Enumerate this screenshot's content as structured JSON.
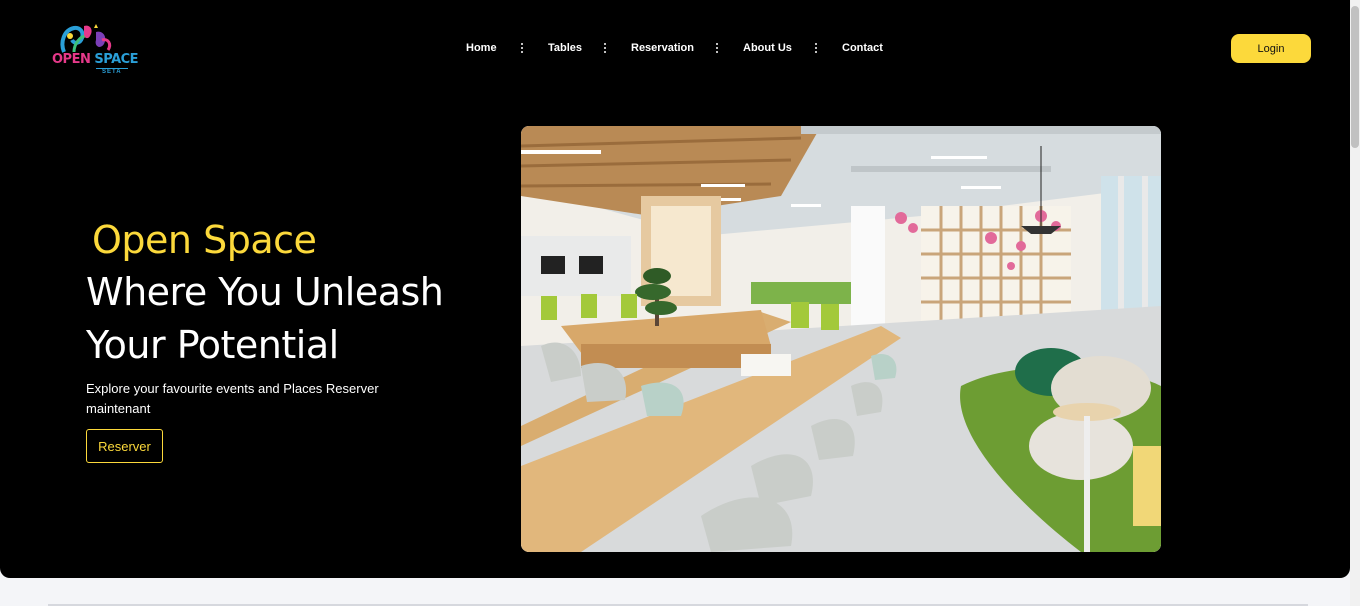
{
  "brand": {
    "logo_word1": "OPEN",
    "logo_word2": "SPACE",
    "logo_sub": "SETA"
  },
  "nav": {
    "items": [
      {
        "label": "Home"
      },
      {
        "label": "Tables"
      },
      {
        "label": "Reservation"
      },
      {
        "label": "About Us"
      },
      {
        "label": "Contact"
      }
    ],
    "login_label": "Login"
  },
  "hero": {
    "accent_title": "Open Space",
    "title_line1": "Where You Unleash",
    "title_line2": "Your Potential",
    "subtitle": "Explore your favourite events and Places Reserver maintenant",
    "cta_label": "Reserver",
    "image_icon": "coworking-office-photo"
  },
  "colors": {
    "background": "#000000",
    "accent": "#fcd93b",
    "text": "#ffffff",
    "logo_pink": "#e6398a",
    "logo_blue": "#2a9fd8"
  }
}
